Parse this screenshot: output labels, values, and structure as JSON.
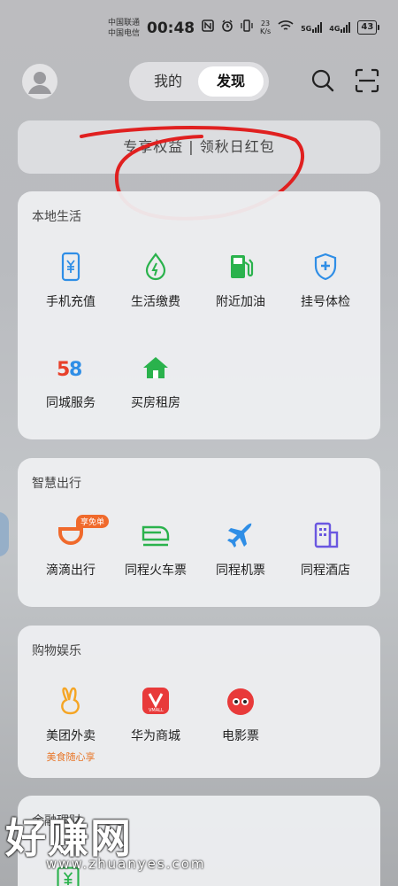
{
  "status_bar": {
    "carrier1": "中国联通",
    "carrier2": "中国电信",
    "time": "00:48",
    "net_speed_value": "23",
    "net_speed_unit": "K/s",
    "sig1": "5G",
    "sig2": "4G",
    "battery": "43"
  },
  "header": {
    "tabs": [
      "我的",
      "发现"
    ],
    "active_tab": "发现"
  },
  "banner": {
    "text": "专享权益 | 领秋日红包"
  },
  "sections": [
    {
      "title": "本地生活",
      "items": [
        {
          "label": "手机充值",
          "icon": "phone-recharge-icon"
        },
        {
          "label": "生活缴费",
          "icon": "utility-payment-icon"
        },
        {
          "label": "附近加油",
          "icon": "gas-station-icon"
        },
        {
          "label": "挂号体检",
          "icon": "medical-shield-icon"
        },
        {
          "label": "同城服务",
          "icon": "58-logo-icon"
        },
        {
          "label": "买房租房",
          "icon": "house-icon"
        }
      ]
    },
    {
      "title": "智慧出行",
      "items": [
        {
          "label": "滴滴出行",
          "icon": "didi-icon",
          "badge": "享免单"
        },
        {
          "label": "同程火车票",
          "icon": "train-icon"
        },
        {
          "label": "同程机票",
          "icon": "airplane-icon"
        },
        {
          "label": "同程酒店",
          "icon": "hotel-icon"
        }
      ]
    },
    {
      "title": "购物娱乐",
      "items": [
        {
          "label": "美团外卖",
          "icon": "meituan-icon",
          "sub": "美食随心享"
        },
        {
          "label": "华为商城",
          "icon": "vmall-icon"
        },
        {
          "label": "电影票",
          "icon": "movie-ticket-icon"
        }
      ]
    },
    {
      "title": "金融理财"
    }
  ],
  "watermark": {
    "text": "好赚网",
    "url": "www.zhuanyes.com"
  },
  "colors": {
    "green": "#2ab24c",
    "blue": "#2f8ee6",
    "orange": "#f06a2c",
    "red_annotation": "#e02020",
    "purple": "#6a57e0"
  }
}
